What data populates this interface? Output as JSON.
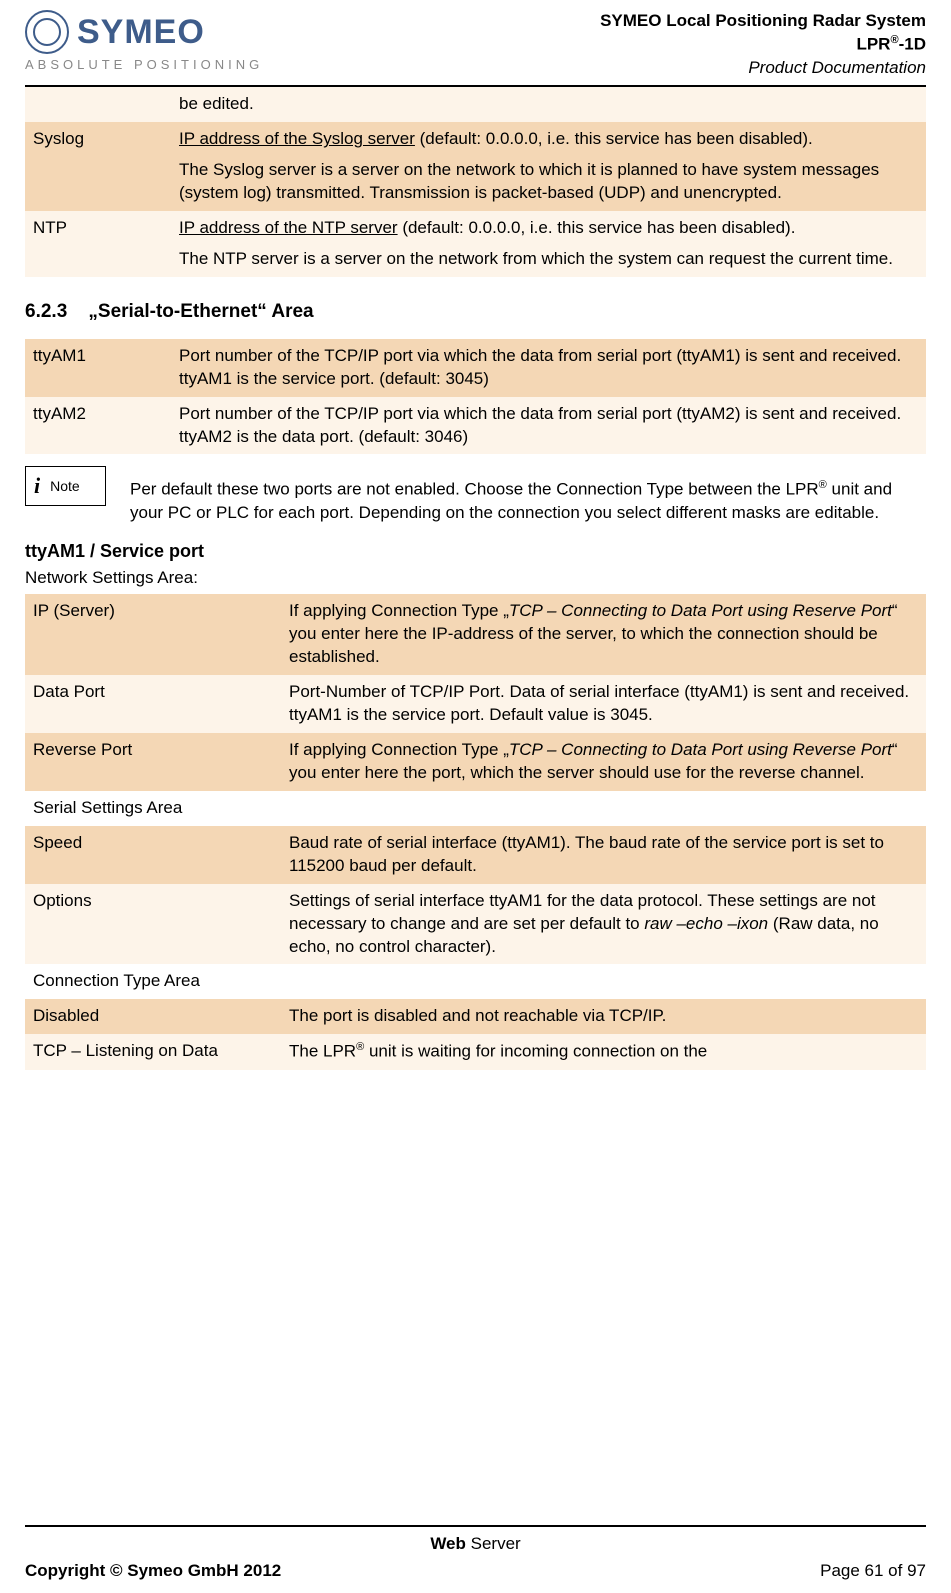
{
  "header": {
    "logo_text": "SYMEO",
    "logo_sub": "ABSOLUTE POSITIONING",
    "title_line1": "SYMEO Local Positioning Radar System",
    "title_line2_prefix": "LPR",
    "title_line2_sup": "®",
    "title_line2_suffix": "-1D",
    "title_line3": "Product Documentation"
  },
  "table1": {
    "r0_continued": "be edited.",
    "r1_label": "Syslog",
    "r1_p1_underline": "IP address of the Syslog server",
    "r1_p1_rest": " (default: 0.0.0.0, i.e. this service has been disabled).",
    "r1_p2": "The Syslog server is a server on the network to which it is planned to have system messages (system log) transmitted. Transmission is packet-based (UDP) and unencrypted.",
    "r2_label": "NTP",
    "r2_p1_underline": "IP address of the NTP server",
    "r2_p1_rest": " (default: 0.0.0.0, i.e. this service has been disabled).",
    "r2_p2": "The NTP server is a server on the network from which the system can request the current time."
  },
  "section_623_number": "6.2.3",
  "section_623_title": "„Serial-to-Ethernet“ Area",
  "table2": {
    "r0_label": "ttyAM1",
    "r0_text": "Port number of the TCP/IP port via which the data from serial port (ttyAM1) is sent and received. ttyAM1 is the service port. (default: 3045)",
    "r1_label": "ttyAM2",
    "r1_text": "Port number of the TCP/IP port via which the data from serial port (ttyAM2) is sent and received. ttyAM2 is the data port. (default: 3046)"
  },
  "note": {
    "icon": "i",
    "label": "Note",
    "text_a": "Per default these two ports are not enabled. Choose the Connection Type between the LPR",
    "text_sup": "®",
    "text_b": " unit and your PC or PLC for each port. Depending on the connection you select different masks are editable."
  },
  "sub_heading": "ttyAM1 / Service port",
  "sub_line": "Network Settings Area:",
  "table3": {
    "r0_label": "IP (Server)",
    "r0_a": "If applying Connection Type „",
    "r0_i": "TCP – Connecting to Data Port using Reserve Port",
    "r0_b": "“ you enter here the IP-address of the server, to which the connection should be established.",
    "r1_label": "Data Port",
    "r1_text": "Port-Number of TCP/IP Port. Data of serial interface (ttyAM1) is sent and received. ttyAM1 is the service port. Default value is 3045.",
    "r2_label": "Reverse Port",
    "r2_a": "If applying Connection Type „",
    "r2_i": "TCP – Connecting to Data Port using Reverse Port",
    "r2_b": "“ you enter here the port, which the server should use for the reverse channel.",
    "r3_full": "Serial Settings Area",
    "r4_label": "Speed",
    "r4_text": "Baud rate of serial interface (ttyAM1). The baud rate of the service port is set to 115200 baud per default.",
    "r5_label": "Options",
    "r5_a": "Settings of serial interface ttyAM1 for the data protocol. These settings are not necessary to change and are set per default to ",
    "r5_i": "raw –echo –ixon",
    "r5_b": " (Raw data, no echo, no control character).",
    "r6_full": "Connection Type Area",
    "r7_label": "Disabled",
    "r7_text": "The port is disabled and not reachable via TCP/IP.",
    "r8_label": "TCP – Listening on Data",
    "r8_a": "The LPR",
    "r8_sup": "®",
    "r8_b": " unit is waiting for incoming connection on the"
  },
  "footer": {
    "center_bold": "Web",
    "center_rest": " Server",
    "left": "Copyright © Symeo GmbH 2012",
    "right": "Page 61 of 97"
  }
}
